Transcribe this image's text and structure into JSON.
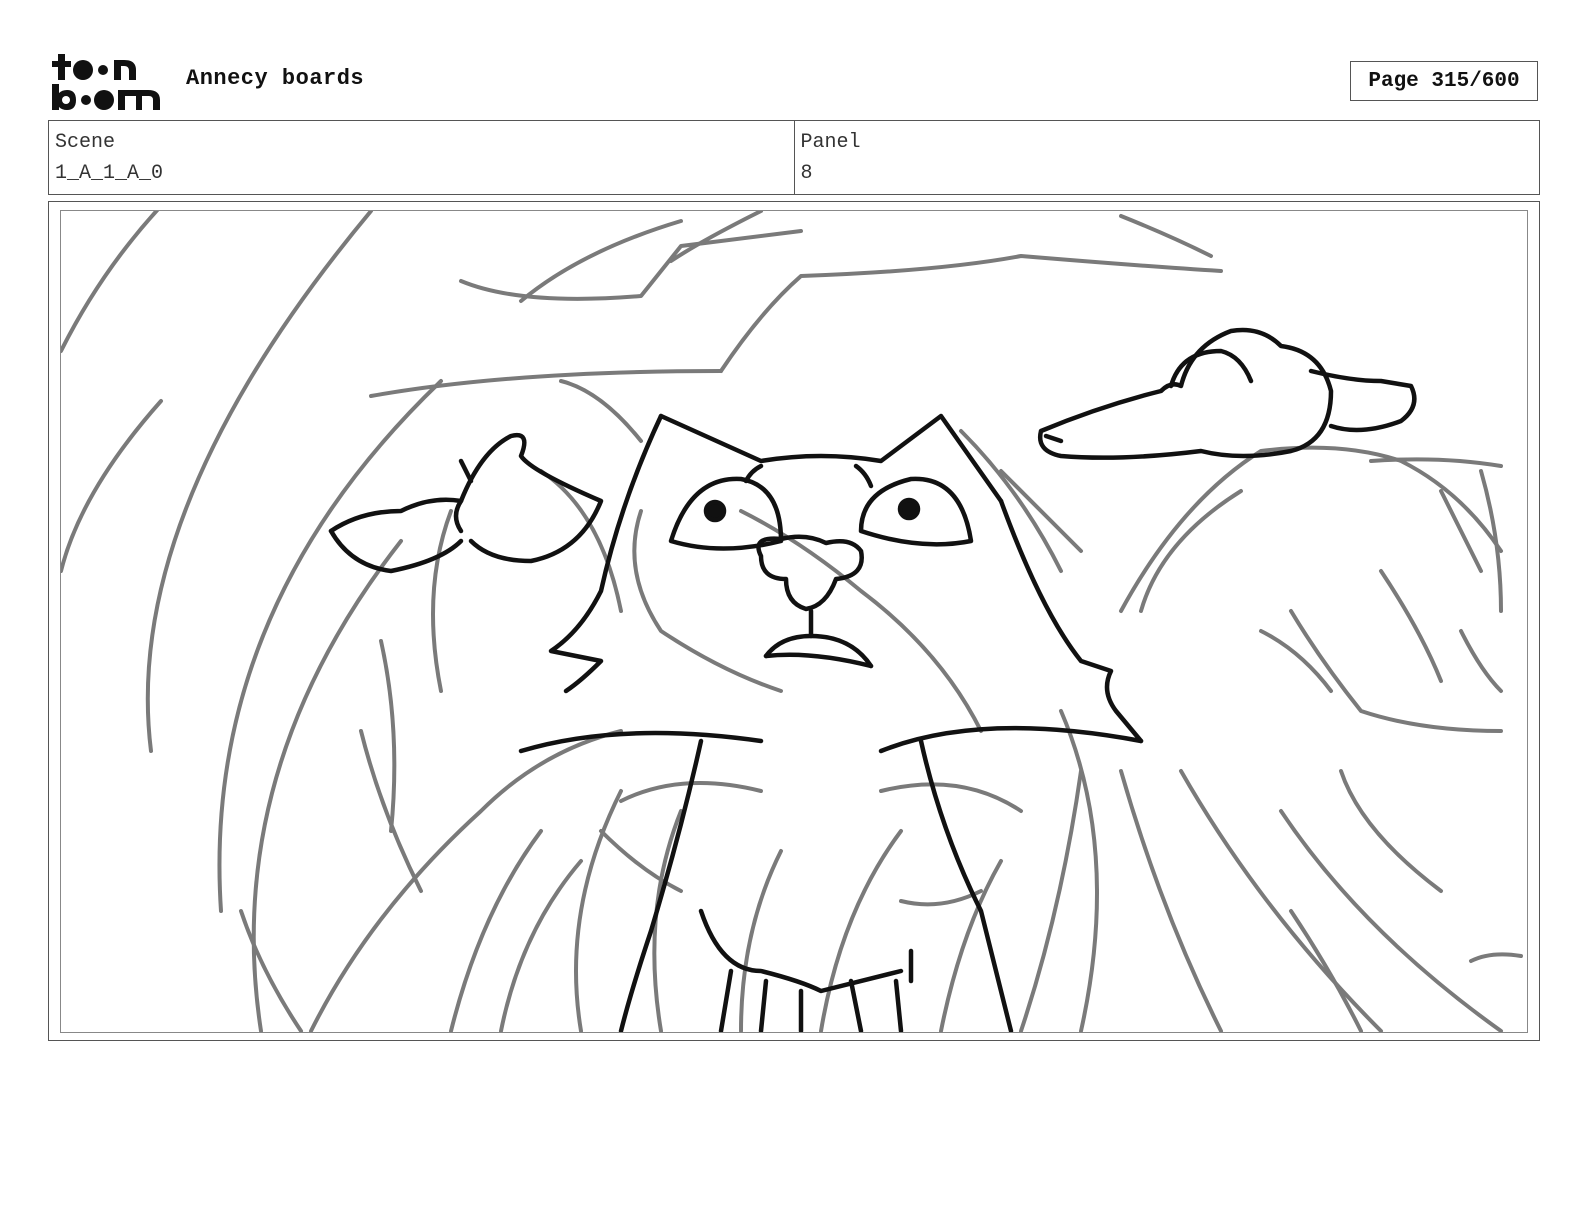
{
  "header": {
    "logo_text_top": "toon",
    "logo_text_bottom": "boom",
    "project_title": "Annecy boards",
    "page_indicator": "Page 315/600"
  },
  "info": {
    "scene_label": "Scene",
    "scene_value": "1_A_1_A_0",
    "panel_label": "Panel",
    "panel_value": "8"
  },
  "colors": {
    "rough_sketch": "#7a7a7a",
    "ink_lines": "#111111",
    "frame_border": "#555555"
  },
  "panel_image": {
    "icon": "storyboard-sketch-cat-and-birds"
  }
}
